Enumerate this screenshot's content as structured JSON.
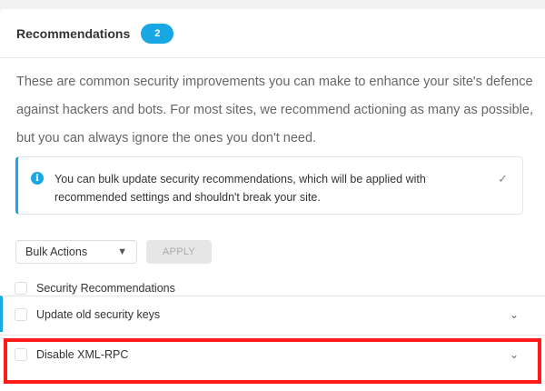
{
  "header": {
    "title": "Recommendations",
    "count": "2"
  },
  "description": "These are common security improvements you can make to enhance your site's defence against hackers and bots. For most sites, we recommend actioning as many as possible, but you can always ignore the ones you don't need.",
  "notice": {
    "icon": "info-icon",
    "text": "You can bulk update security recommendations, which will be applied with recommended settings and shouldn't break your site.",
    "check_icon": "✓"
  },
  "bulk": {
    "select_value": "Bulk Actions",
    "apply_label": "APPLY"
  },
  "list": {
    "header_label": "Security Recommendations",
    "items": [
      {
        "label": "Update old security keys"
      },
      {
        "label": "Disable XML-RPC"
      }
    ]
  },
  "colors": {
    "accent": "#17a8e3",
    "highlight": "#ff1a1a"
  }
}
